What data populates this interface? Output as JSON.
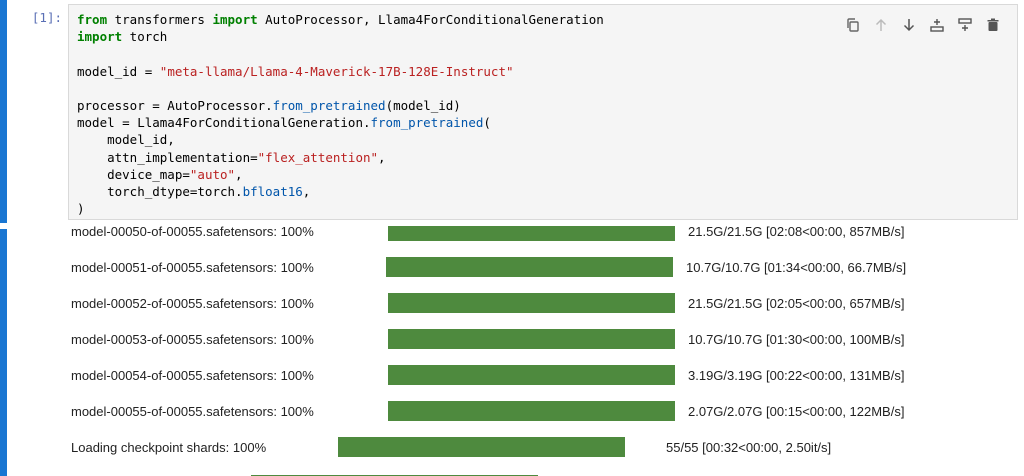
{
  "cell": {
    "prompt": "[1]:",
    "code_lines": [
      [
        {
          "t": "kw",
          "v": "from"
        },
        {
          "t": "",
          "v": " transformers "
        },
        {
          "t": "kw",
          "v": "import"
        },
        {
          "t": "",
          "v": " AutoProcessor, Llama4ForConditionalGeneration"
        }
      ],
      [
        {
          "t": "kw",
          "v": "import"
        },
        {
          "t": "",
          "v": " torch"
        }
      ],
      [],
      [
        {
          "t": "",
          "v": "model_id = "
        },
        {
          "t": "str",
          "v": "\"meta-llama/Llama-4-Maverick-17B-128E-Instruct\""
        }
      ],
      [],
      [
        {
          "t": "",
          "v": "processor = AutoProcessor."
        },
        {
          "t": "fn",
          "v": "from_pretrained"
        },
        {
          "t": "",
          "v": "(model_id)"
        }
      ],
      [
        {
          "t": "",
          "v": "model = Llama4ForConditionalGeneration."
        },
        {
          "t": "fn",
          "v": "from_pretrained"
        },
        {
          "t": "",
          "v": "("
        }
      ],
      [
        {
          "t": "",
          "v": "    model_id,"
        }
      ],
      [
        {
          "t": "",
          "v": "    attn_implementation="
        },
        {
          "t": "str",
          "v": "\"flex_attention\""
        },
        {
          "t": "",
          "v": ","
        }
      ],
      [
        {
          "t": "",
          "v": "    device_map="
        },
        {
          "t": "str",
          "v": "\"auto\""
        },
        {
          "t": "",
          "v": ","
        }
      ],
      [
        {
          "t": "",
          "v": "    torch_dtype=torch."
        },
        {
          "t": "fn",
          "v": "bfloat16"
        },
        {
          "t": "",
          "v": ","
        }
      ],
      [
        {
          "t": "",
          "v": ")"
        }
      ]
    ]
  },
  "toolbar": {
    "icons": [
      "duplicate-icon",
      "move-up-icon",
      "move-down-icon",
      "insert-above-icon",
      "insert-below-icon",
      "delete-icon"
    ]
  },
  "progress": [
    {
      "label": "model-00050-of-00055.safetensors:  100%",
      "stats": "21.5G/21.5G  [02:08<00:00,  857MB/s]",
      "fraction": 1.0
    },
    {
      "label": "model-00051-of-00055.safetensors:  100%",
      "stats": "10.7G/10.7G  [01:34<00:00,  66.7MB/s]",
      "fraction": 1.0
    },
    {
      "label": "model-00052-of-00055.safetensors:  100%",
      "stats": "21.5G/21.5G  [02:05<00:00,  657MB/s]",
      "fraction": 1.0
    },
    {
      "label": "model-00053-of-00055.safetensors:  100%",
      "stats": "10.7G/10.7G  [01:30<00:00,  100MB/s]",
      "fraction": 1.0
    },
    {
      "label": "model-00054-of-00055.safetensors:  100%",
      "stats": "3.19G/3.19G  [00:22<00:00,  131MB/s]",
      "fraction": 1.0
    },
    {
      "label": "model-00055-of-00055.safetensors:  100%",
      "stats": "2.07G/2.07G  [00:15<00:00,  122MB/s]",
      "fraction": 1.0
    },
    {
      "label": "Loading  checkpoint  shards:  100%",
      "stats": "55/55  [00:32<00:00,    2.50it/s]",
      "fraction": 1.0
    }
  ],
  "colors": {
    "accent": "#1976d2",
    "progress_fill": "#4e8a3e"
  }
}
